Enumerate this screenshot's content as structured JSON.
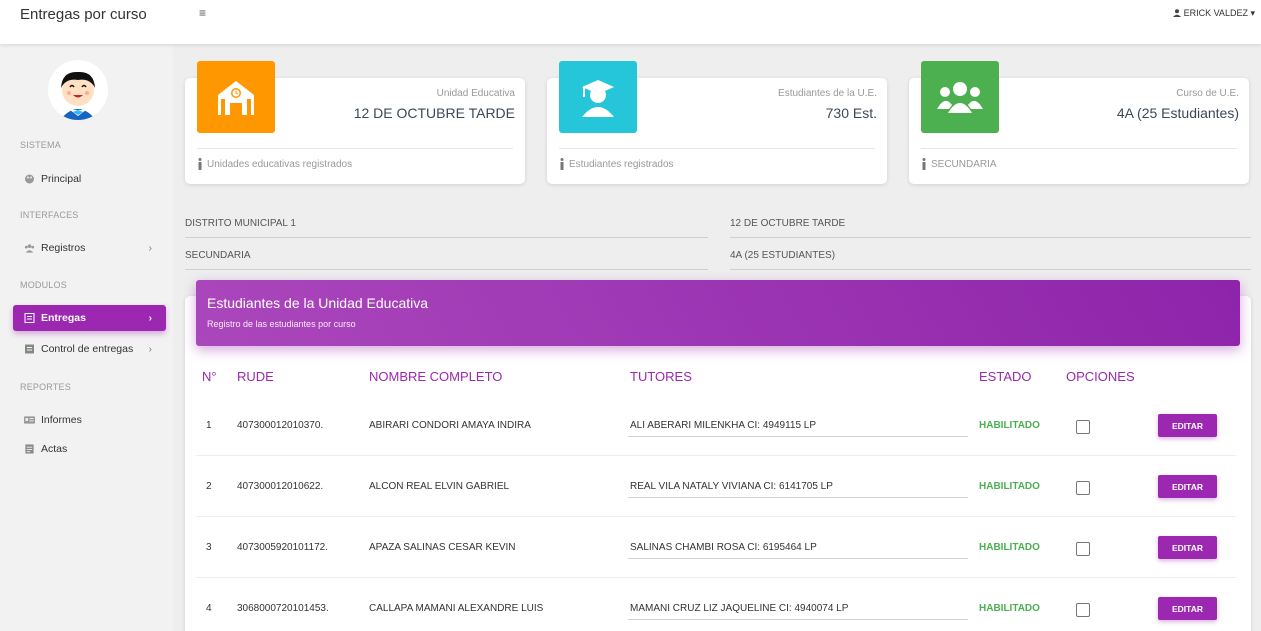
{
  "app": {
    "title": "Entregas por curso",
    "menu_glyph": "≡",
    "user_label": "ERICK VALDEZ",
    "user_caret": "▾"
  },
  "sidebar": {
    "sections": [
      {
        "label": "SISTEMA"
      },
      {
        "label": "INTERFACES"
      },
      {
        "label": "MODULOS"
      },
      {
        "label": "REPORTES"
      }
    ],
    "items": [
      {
        "label": "Principal",
        "icon": "palette-icon",
        "chevron": ""
      },
      {
        "label": "Registros",
        "icon": "users-icon",
        "chevron": "›"
      },
      {
        "label": "Entregas",
        "icon": "clipboard-icon",
        "chevron": "›",
        "active": true
      },
      {
        "label": "Control de entregas",
        "icon": "clipboard-icon",
        "chevron": "›"
      },
      {
        "label": "Informes",
        "icon": "id-card-icon",
        "chevron": ""
      },
      {
        "label": "Actas",
        "icon": "document-icon",
        "chevron": ""
      }
    ]
  },
  "cards": [
    {
      "category": "Unidad Educativa",
      "title": "12 DE OCTUBRE TARDE",
      "footer": "Unidades educativas registrados",
      "icon": "school-icon",
      "color": "#ff9800"
    },
    {
      "category": "Estudiantes de la U.E.",
      "title": "730 Est.",
      "footer": "Estudiantes registrados",
      "icon": "graduate-icon",
      "color": "#26c6da"
    },
    {
      "category": "Curso de U.E.",
      "title": "4A (25 Estudiantes)",
      "footer": "SECUNDARIA",
      "icon": "group-icon",
      "color": "#4caf50"
    }
  ],
  "info": {
    "distrito": "DISTRITO MUNICIPAL 1",
    "unidad": "12 DE OCTUBRE TARDE",
    "nivel": "SECUNDARIA",
    "curso": "4A (25 ESTUDIANTES)"
  },
  "table": {
    "title": "Estudiantes de la Unidad Educativa",
    "subtitle": "Registro de las estudiantes por curso",
    "headers": [
      "N°",
      "RUDE",
      "NOMBRE COMPLETO",
      "TUTORES",
      "ESTADO",
      "OPCIONES"
    ],
    "edit_label": "EDITAR",
    "rows": [
      {
        "n": "1",
        "rude": "407300012010370.",
        "nombre": "ABIRARI CONDORI AMAYA INDIRA",
        "tutor": "ALI ABERARI MILENKHA CI: 4949115 LP",
        "estado": "HABILITADO"
      },
      {
        "n": "2",
        "rude": "407300012010622.",
        "nombre": "ALCON REAL ELVIN GABRIEL",
        "tutor": "REAL VILA NATALY VIVIANA CI: 6141705 LP",
        "estado": "HABILITADO"
      },
      {
        "n": "3",
        "rude": "4073005920101172.",
        "nombre": "APAZA SALINAS CESAR KEVIN",
        "tutor": "SALINAS CHAMBI ROSA CI: 6195464 LP",
        "estado": "HABILITADO"
      },
      {
        "n": "4",
        "rude": "3068000720101453.",
        "nombre": "CALLAPA MAMANI ALEXANDRE LUIS",
        "tutor": "MAMANI CRUZ LIZ JAQUELINE CI: 4940074 LP",
        "estado": "HABILITADO"
      }
    ]
  }
}
